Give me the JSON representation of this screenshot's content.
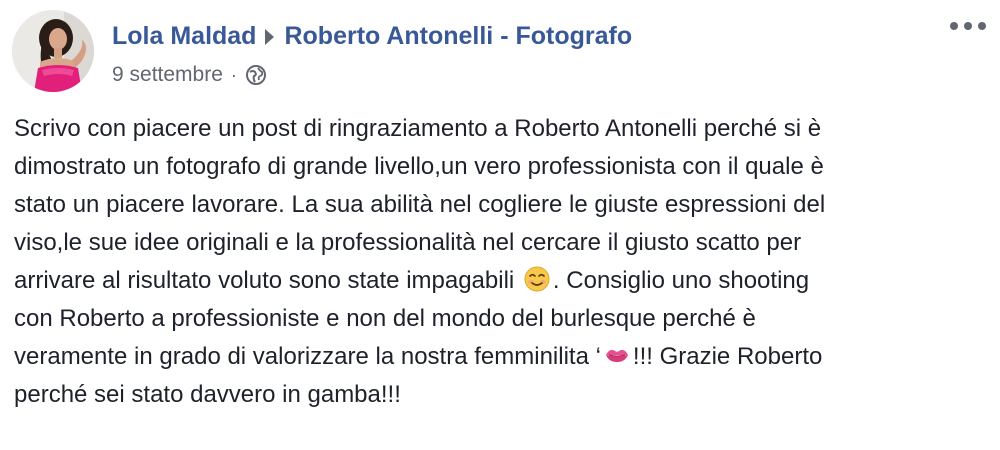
{
  "post": {
    "author": "Lola Maldad",
    "page_name": "Roberto Antonelli - Fotografo",
    "date": "9 settembre",
    "separator": "·",
    "privacy_icon": "globe-icon",
    "more_icon": "more-options-icon",
    "text_lines": [
      "Scrivo con piacere un post di ringraziamento a Roberto Antonelli perché si è",
      "dimostrato un fotografo di grande livello,un vero professionista con il quale è",
      "stato un piacere lavorare. La sua abilità nel cogliere le giuste espressioni del",
      "viso,le sue idee originali e la professionalità nel cercare il giusto scatto per",
      "arrivare al risultato voluto sono state impagabili",
      ". Consiglio uno shooting",
      "con Roberto a professioniste e non del mondo del burlesque perché è",
      "veramente in grado di valorizzare la nostra femminilita ‘",
      "!!! Grazie Roberto",
      "perché sei stato davvero in gamba!!!"
    ],
    "emojis": [
      "smiling-face-emoji",
      "kiss-mark-emoji"
    ],
    "colors": {
      "link": "#385898",
      "meta": "#616770",
      "text": "#1d2129",
      "avatar_dress": "#e0207a"
    }
  }
}
